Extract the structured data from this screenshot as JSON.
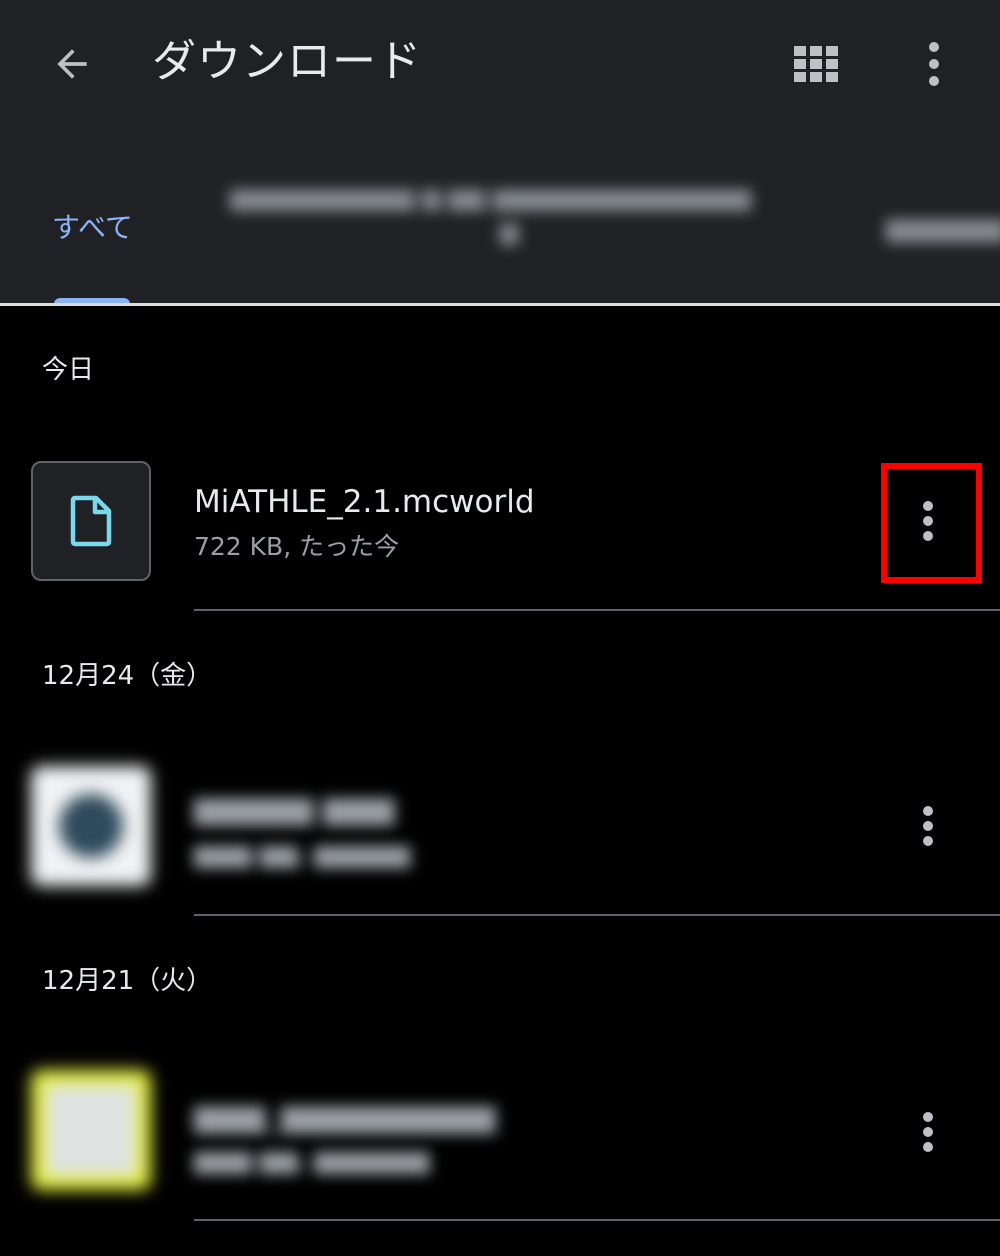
{
  "header": {
    "title": "ダウンロード",
    "back_icon": "arrow-back-icon",
    "grid_icon": "grid-view-icon",
    "menu_icon": "more-vert-icon"
  },
  "tabs": [
    {
      "label": "すべて",
      "selected": true
    }
  ],
  "sections": [
    {
      "header": "今日",
      "items": [
        {
          "name": "MiATHLE_2.1.mcworld",
          "meta": "722 KB, たった今",
          "icon": "file-icon"
        }
      ]
    },
    {
      "header": "12月24（金）",
      "items": [
        {
          "icon": "image-thumbnail"
        }
      ]
    },
    {
      "header": "12月21（火）",
      "items": [
        {
          "icon": "image-thumbnail"
        }
      ]
    }
  ],
  "colors": {
    "appbar_bg": "#202124",
    "accent": "#8ab4f8",
    "file_icon": "#78d9ec",
    "highlight": "#ff0000"
  }
}
